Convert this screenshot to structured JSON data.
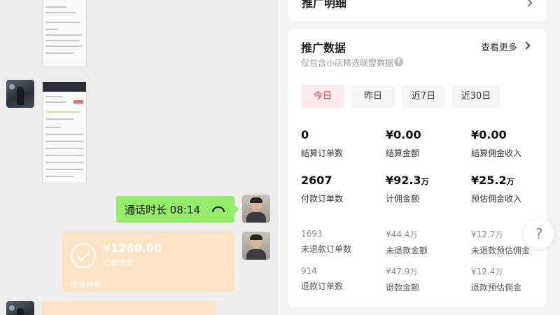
{
  "chat": {
    "call_bubble": {
      "text": "通话时长 08:14",
      "icon": "phone-hangup-icon"
    },
    "transfer": {
      "amount": "¥1280.00",
      "status": "已被接收",
      "footer": "微信转账",
      "icon": "check-circle-icon"
    }
  },
  "promo": {
    "header_partial": "推广明细",
    "card": {
      "title": "推广数据",
      "more": "查看更多",
      "subtitle": "仅包含小店精选联盟数据",
      "tabs": [
        "今日",
        "昨日",
        "近7日",
        "近30日"
      ],
      "active_tab": "今日",
      "primary_stats": [
        {
          "value": "0",
          "unit": "",
          "label": "结算订单数"
        },
        {
          "value": "¥0.00",
          "unit": "",
          "label": "结算金额"
        },
        {
          "value": "¥0.00",
          "unit": "",
          "label": "结算佣金收入"
        },
        {
          "value": "2607",
          "unit": "",
          "label": "付款订单数"
        },
        {
          "value": "¥92.3",
          "unit": "万",
          "label": "计佣金额"
        },
        {
          "value": "¥25.2",
          "unit": "万",
          "label": "预估佣金收入"
        }
      ],
      "secondary_stats": [
        {
          "value": "1693",
          "unit": "",
          "label": "未退款订单数"
        },
        {
          "value": "¥44.4",
          "unit": "万",
          "label": "未退款金额"
        },
        {
          "value": "¥12.7",
          "unit": "万",
          "label": "未退款预估佣金"
        },
        {
          "value": "914",
          "unit": "",
          "label": "退款订单数"
        },
        {
          "value": "¥47.9",
          "unit": "万",
          "label": "退款金额"
        },
        {
          "value": "¥12.4",
          "unit": "万",
          "label": "退款预估佣金"
        }
      ]
    },
    "help_button": "?"
  },
  "colors": {
    "accent": "#e8334a",
    "chat_green": "#95ec69",
    "transfer_bg": "#fbe3c3"
  }
}
